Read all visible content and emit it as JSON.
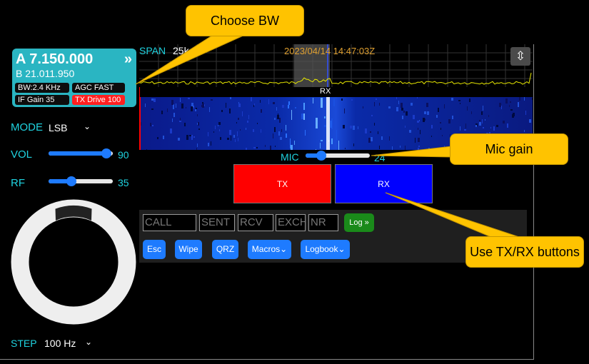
{
  "vfo": {
    "a_freq": "A 7.150.000",
    "b_freq": "B 21.011.950",
    "expand_glyph": "»",
    "bw": "BW:2.4 KHz",
    "agc": "AGC FAST",
    "if_gain": "IF Gain 35",
    "tx_drive": "TX Drive 100"
  },
  "controls": {
    "mode_label": "MODE",
    "mode_value": "LSB",
    "vol_label": "VOL",
    "vol_value": "90",
    "vol_fraction": 0.9,
    "rf_label": "RF",
    "rf_value": "35",
    "rf_fraction": 0.35,
    "step_label": "STEP",
    "step_value": "100 Hz",
    "chevron": "⌄"
  },
  "spectrum": {
    "span_label": "SPAN",
    "span_value": "25k",
    "timestamp": "2023/04/14 14:47:03Z",
    "rx_marker": "RX",
    "zoom_glyph": "⇳"
  },
  "mic": {
    "label": "MIC",
    "value": "24",
    "fraction": 0.24
  },
  "buttons": {
    "tx": "TX",
    "rx": "RX"
  },
  "logger": {
    "fields": [
      {
        "name": "call-field",
        "placeholder": "CALL"
      },
      {
        "name": "sent-field",
        "placeholder": "SENT"
      },
      {
        "name": "rcv-field",
        "placeholder": "RCV"
      },
      {
        "name": "exch-field",
        "placeholder": "EXCH"
      },
      {
        "name": "nr-field",
        "placeholder": "NR"
      }
    ],
    "log_button": "Log »",
    "esc": "Esc",
    "wipe": "Wipe",
    "qrz": "QRZ",
    "macros": "Macros⌄",
    "logbook": "Logbook⌄"
  },
  "callouts": {
    "choose_bw": "Choose BW",
    "mic_gain": "Mic gain",
    "use_txrx": "Use TX/RX buttons"
  },
  "colors": {
    "accent_cyan": "#1fd3e0",
    "vfo_bg": "#2ab5c2",
    "slider_blue": "#1e7bff",
    "tx_red": "#ff0000",
    "rx_blue": "#0000ff",
    "callout_yellow": "#ffc300",
    "log_green": "#1a8a1a"
  }
}
